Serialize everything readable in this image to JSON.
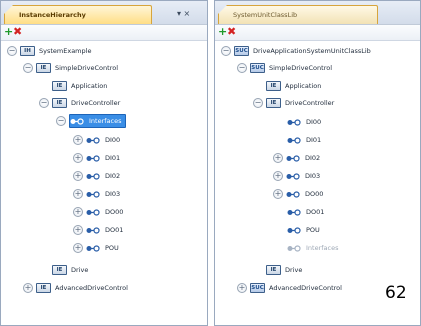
{
  "left_panel": {
    "tab_title": "InstanceHierarchy",
    "pin_glyph": "▾ ×",
    "tree": [
      {
        "label": "SystemExample",
        "icon": "IH"
      },
      {
        "label": "SimpleDriveControl",
        "icon": "IE"
      },
      {
        "label": "Application",
        "icon": "IE"
      },
      {
        "label": "DriveController",
        "icon": "IE"
      },
      {
        "label": "Interfaces",
        "icon": "interface"
      },
      {
        "label": "DI00",
        "icon": "interface"
      },
      {
        "label": "DI01",
        "icon": "interface"
      },
      {
        "label": "DI02",
        "icon": "interface"
      },
      {
        "label": "DI03",
        "icon": "interface"
      },
      {
        "label": "DO00",
        "icon": "interface"
      },
      {
        "label": "DO01",
        "icon": "interface"
      },
      {
        "label": "POU",
        "icon": "interface"
      },
      {
        "label": "Drive",
        "icon": "IE"
      },
      {
        "label": "AdvancedDriveControl",
        "icon": "IE"
      }
    ]
  },
  "right_panel": {
    "tab_title": "SystemUnitClassLib",
    "tree": [
      {
        "label": "DriveApplicationSystemUnitClassLib",
        "icon": "SUC"
      },
      {
        "label": "SimpleDriveControl",
        "icon": "SUC"
      },
      {
        "label": "Application",
        "icon": "IE"
      },
      {
        "label": "DriveController",
        "icon": "IE"
      },
      {
        "label": "DI00",
        "icon": "interface"
      },
      {
        "label": "DI01",
        "icon": "interface"
      },
      {
        "label": "DI02",
        "icon": "interface"
      },
      {
        "label": "DI03",
        "icon": "interface"
      },
      {
        "label": "DO00",
        "icon": "interface"
      },
      {
        "label": "DO01",
        "icon": "interface"
      },
      {
        "label": "POU",
        "icon": "interface"
      },
      {
        "label": "Interfaces",
        "icon": "interface"
      },
      {
        "label": "Drive",
        "icon": "IE"
      },
      {
        "label": "AdvancedDriveControl",
        "icon": "SUC"
      }
    ]
  },
  "toolbar": {
    "add_glyph": "+",
    "delete_glyph": "✖"
  },
  "page_number": "62",
  "colors": {
    "selection": "#3a8ee6",
    "tab_active": "#ffde86",
    "add": "#1f9a2b",
    "delete": "#d42323"
  }
}
